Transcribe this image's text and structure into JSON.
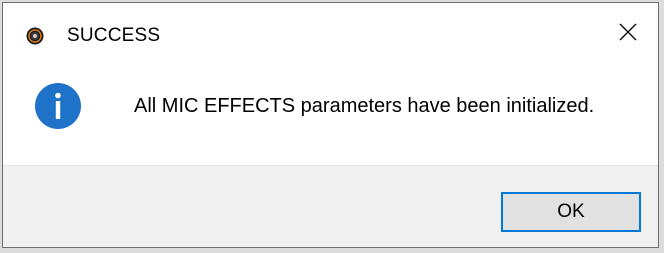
{
  "window": {
    "title": "SUCCESS",
    "app_icon": "app-logo-icon",
    "close_icon": "close-icon"
  },
  "dialog": {
    "icon": "info-icon",
    "message": "All MIC EFFECTS parameters have been initialized."
  },
  "buttons": {
    "ok_label": "OK"
  },
  "colors": {
    "accent": "#0078d7",
    "info_blue": "#1e73c8",
    "footer_bg": "#f0f0f0"
  }
}
